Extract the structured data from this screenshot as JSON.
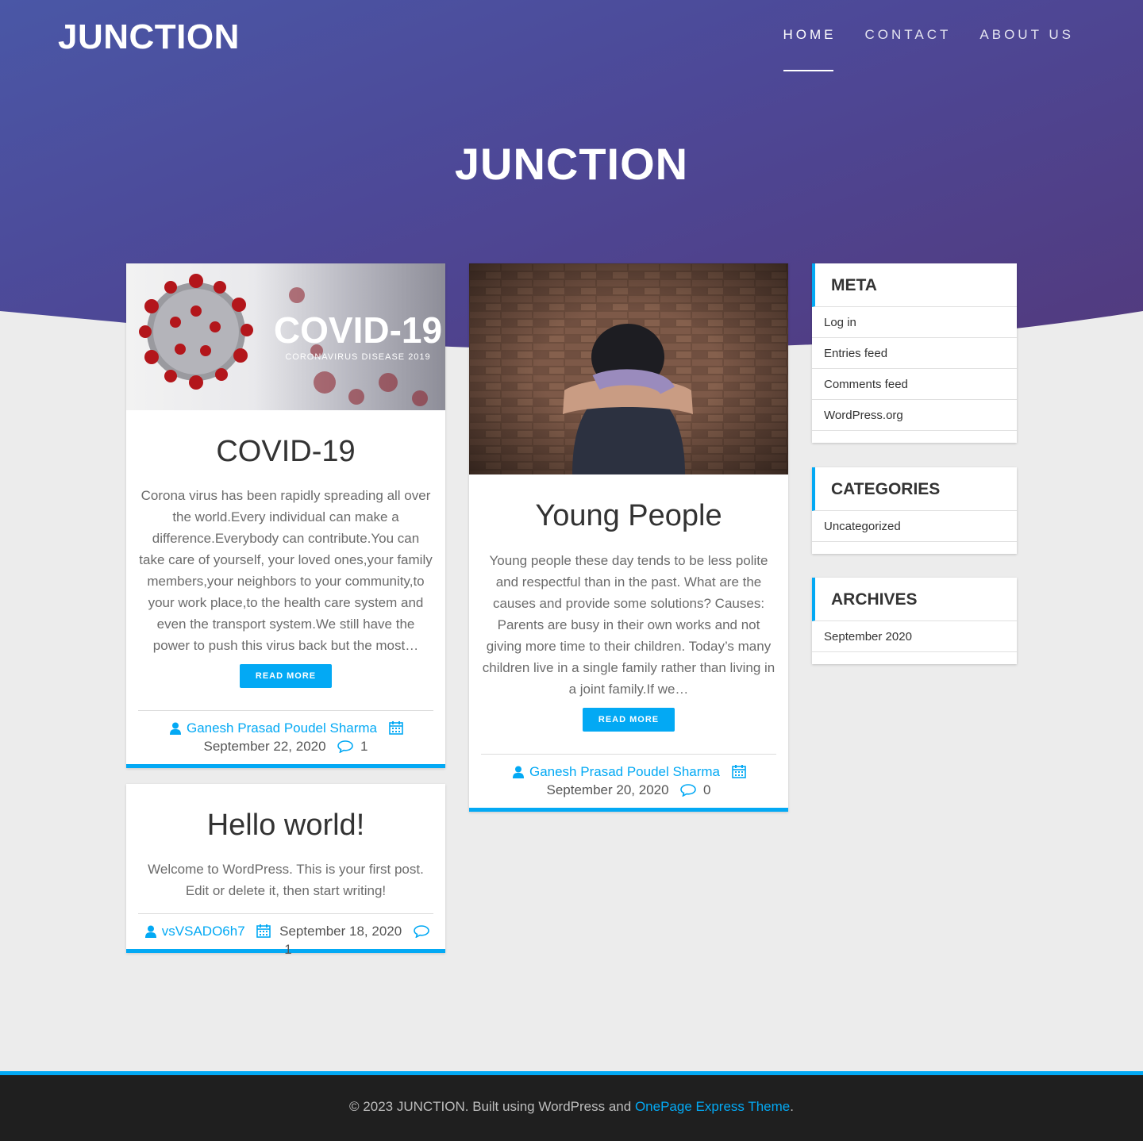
{
  "header": {
    "logo": "JUNCTION",
    "nav": [
      {
        "label": "HOME",
        "active": true
      },
      {
        "label": "CONTACT",
        "active": false
      },
      {
        "label": "ABOUT US",
        "active": false
      }
    ],
    "hero_title": "JUNCTION"
  },
  "posts": [
    {
      "title": "COVID-19",
      "image_text": "COVID-19",
      "image_subtext": "CORONAVIRUS DISEASE 2019",
      "excerpt": "Corona virus has been rapidly spreading all over the world.Every individual can make a difference.Everybody can contribute.You can take care of yourself, your loved ones,your family members,your neighbors to your community,to your work place,to the health care system and even the transport system.We still have the power to push this virus back but the most…",
      "button": "READ MORE",
      "author": "Ganesh Prasad Poudel Sharma",
      "date": "September 22, 2020",
      "comments": "1"
    },
    {
      "title": "Young People",
      "excerpt": "Young people these day tends to be less polite and respectful than in the past. What are the causes and provide some solutions? Causes: Parents are busy in their own works and not giving more time to their children. Today’s many children live in a single family rather than living in a joint family.If we…",
      "button": "READ MORE",
      "author": "Ganesh Prasad Poudel Sharma",
      "date": "September 20, 2020",
      "comments": "0"
    },
    {
      "title": "Hello world!",
      "excerpt": "Welcome to WordPress. This is your first post. Edit or delete it, then start writing!",
      "author": "vsVSADO6h7",
      "date": "September 18, 2020",
      "comments": "1"
    }
  ],
  "sidebar": {
    "meta": {
      "title": "META",
      "items": [
        "Log in",
        "Entries feed",
        "Comments feed",
        "WordPress.org"
      ]
    },
    "categories": {
      "title": "CATEGORIES",
      "items": [
        "Uncategorized"
      ]
    },
    "archives": {
      "title": "ARCHIVES",
      "items": [
        "September 2020"
      ]
    }
  },
  "footer": {
    "text": "©  2023  JUNCTION. Built using WordPress and ",
    "link": "OnePage Express Theme",
    "end": "."
  },
  "colors": {
    "accent": "#03a9f4",
    "hero_start": "#4a57a6",
    "hero_end": "#523a7e",
    "footer_bg": "#1f1f1f"
  }
}
